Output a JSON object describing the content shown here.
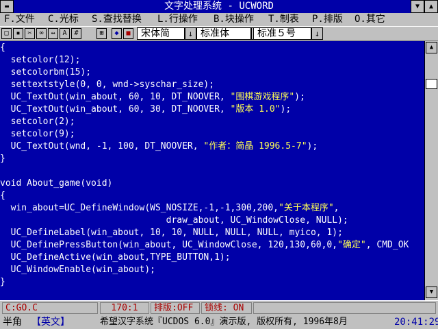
{
  "window": {
    "title": "文字处理系统 - UCWORD"
  },
  "menu": [
    "F.文件",
    "C.光标",
    "S.查找替换",
    "L.行操作",
    "B.块操作",
    "T.制表",
    "P.排版",
    "O.其它"
  ],
  "toolbar": {
    "buttons": [
      "new-icon",
      "save-icon",
      "cut-icon",
      "binoculars-icon",
      "find-replace-icon",
      "font-icon",
      "grid-icon",
      "table-icon",
      "color-icon",
      "mark-icon"
    ],
    "font_face": "宋体简",
    "font_style": "标准体",
    "font_size": "标准５号"
  },
  "editor": {
    "lines": [
      [
        {
          "t": "{"
        }
      ],
      [
        {
          "t": "  setcolor(12);"
        }
      ],
      [
        {
          "t": "  setcolorbm(15);"
        }
      ],
      [
        {
          "t": "  settextstyle(0, 0, wnd->syschar_size);"
        }
      ],
      [
        {
          "t": "  UC_TextOut(win_about, 60, 10, DT_NOOVER, "
        },
        {
          "t": "\"围棋游戏程序\"",
          "s": 1
        },
        {
          "t": ");"
        }
      ],
      [
        {
          "t": "  UC_TextOut(win_about, 60, 30, DT_NOOVER, "
        },
        {
          "t": "\"版本 1.0\"",
          "s": 1
        },
        {
          "t": ");"
        }
      ],
      [
        {
          "t": "  setcolor(2);"
        }
      ],
      [
        {
          "t": "  setcolor(9);"
        }
      ],
      [
        {
          "t": "  UC_TextOut(wnd, -1, 100, DT_NOOVER, "
        },
        {
          "t": "\"作者：简晶 1996.5-7\"",
          "s": 1
        },
        {
          "t": ");"
        }
      ],
      [
        {
          "t": "}"
        }
      ],
      [
        {
          "t": ""
        }
      ],
      [
        {
          "t": "void About_game(void)"
        }
      ],
      [
        {
          "t": "{"
        }
      ],
      [
        {
          "t": "  win_about=UC_DefineWindow(WS_NOSIZE,-1,-1,300,200,"
        },
        {
          "t": "\"关于本程序\"",
          "s": 1
        },
        {
          "t": ","
        }
      ],
      [
        {
          "t": "                               draw_about, UC_WindowClose, NULL);"
        }
      ],
      [
        {
          "t": "  UC_DefineLabel(win_about, 10, 10, NULL, NULL, NULL, myico, 1);"
        }
      ],
      [
        {
          "t": "  UC_DefinePressButton(win_about, UC_WindowClose, 120,130,60,0,"
        },
        {
          "t": "\"确定\"",
          "s": 1
        },
        {
          "t": ", CMD_OK"
        }
      ],
      [
        {
          "t": "  UC_DefineActive(win_about,TYPE_BUTTON,1);"
        }
      ],
      [
        {
          "t": "  UC_WindowEnable(win_about);"
        }
      ],
      [
        {
          "t": "}"
        }
      ]
    ]
  },
  "status": {
    "file": "C:GO.C",
    "position": "170:1",
    "layout": "排版:OFF",
    "lock": "锁线: ON"
  },
  "ime": {
    "width": "半角",
    "lang": "【英文】",
    "system": "希望汉字系统『UCDOS 6.0』演示版, 版权所有, 1996年8月",
    "time": "20:41:29"
  },
  "colors": {
    "editor_bg": "#0000a8",
    "code_text": "#ffffff",
    "string_text": "#ffff55",
    "status_text": "#a80000"
  }
}
